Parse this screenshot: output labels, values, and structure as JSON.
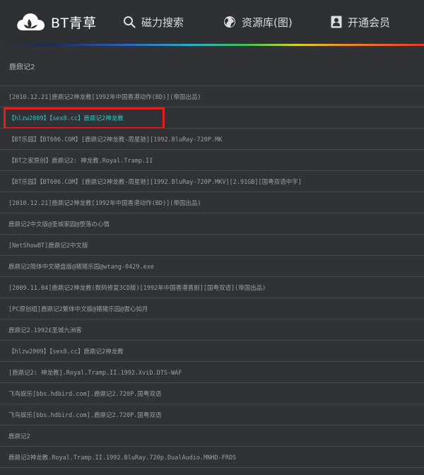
{
  "nav": {
    "brand": "BT青草",
    "search": "磁力搜索",
    "resources": "资源库(图)",
    "vip": "开通会员"
  },
  "query": "鹿鼎记2",
  "results": [
    {
      "title": "[2010.12.21]鹿鼎记2神龙教[1992年中国香港动作(BD)](帝国出品)"
    },
    {
      "title": "【hlzw2009】【sex8.cc】鹿鼎记2神龙教",
      "highlight": true
    },
    {
      "title": "【BT乐园】【BT606.COM】[鹿鼎记2神龙教-周星驰][1992.BluRay-720P.MK"
    },
    {
      "title": "【BT之家原创】鹿鼎记2: 神龙教.Royal.Tramp.II"
    },
    {
      "title": "【BT乐园】【BT606.COM】[鹿鼎记2神龙教-周星驰][1992.BluRay-720P.MKV][2.91GB][国粤双语中字]"
    },
    {
      "title": "[2010.12.21]鹿鼎记2神龙教[1992年中国香港动作(BD)](帝国出品)"
    },
    {
      "title": "鹿鼎记2中文版@圣城家园@堕落の心情"
    },
    {
      "title": "[NetShowBT]鹿鼎记2中文版"
    },
    {
      "title": "鹿鼎记2简体中文硬盘版@猪猪乐园@wtang-0429.exe"
    },
    {
      "title": "[2009.11.04]鹿鼎记2神龙教(数码修复3CD版)[1992年中国香港喜剧][国粤双语](帝国出品)"
    },
    {
      "title": "[PC原创组]鹿鼎记2繁体中文版@猪猪乐园@雲心如月"
    },
    {
      "title": "鹿鼎记2.1992£圣城九洲客"
    },
    {
      "title": "【hlzw2009】【sex8.cc】鹿鼎记2神龙教"
    },
    {
      "title": "[鹿鼎记2: 神龙教].Royal.Tramp.II.1992.XviD.DTS-WAF"
    },
    {
      "title": "飞鸟娱乐[bbs.hdbird.com].鹿鼎记2.720P.国粤双语"
    },
    {
      "title": "飞鸟娱乐[bbs.hdbird.com].鹿鼎记2.720P.国粤双语"
    },
    {
      "title": "鹿鼎记2"
    },
    {
      "title": "鹿鼎记2神龙教.Royal.Tramp.II.1992.BluRay.720p.DualAudio.MNHD-FRDS"
    }
  ],
  "colors": {
    "background": "#303236",
    "highlight_text": "#2ec9c2",
    "annotation_box": "#e02020"
  }
}
